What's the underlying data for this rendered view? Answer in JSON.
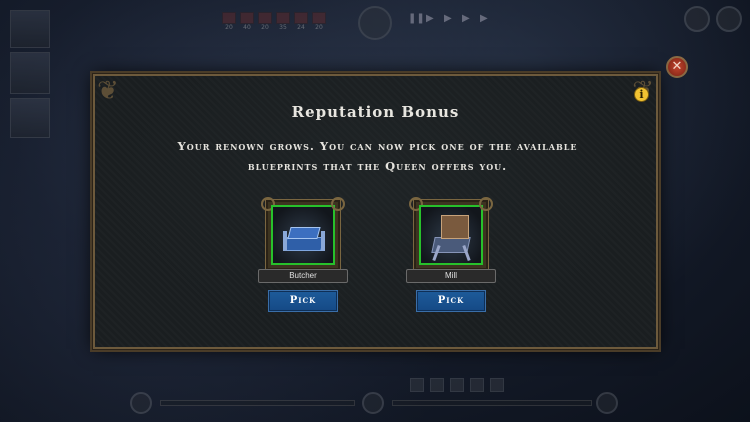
{
  "hud": {
    "resources": [
      "20",
      "40",
      "20",
      "35",
      "24",
      "20"
    ]
  },
  "dialog": {
    "title": "Reputation Bonus",
    "description": "Your renown grows. You can now pick one of the available blueprints that the Queen offers you.",
    "info_icon_glyph": "i",
    "close_icon_glyph": "✕",
    "options": [
      {
        "name": "Butcher",
        "pick_label": "Pick",
        "icon": "butcher-building-icon"
      },
      {
        "name": "Mill",
        "pick_label": "Pick",
        "icon": "mill-building-icon"
      }
    ]
  },
  "colors": {
    "accent_green": "#27c12b",
    "pick_button": "#1d5a99",
    "frame_gold": "#6d5a3c",
    "info_yellow": "#f1c232",
    "close_red": "#c2462f"
  }
}
